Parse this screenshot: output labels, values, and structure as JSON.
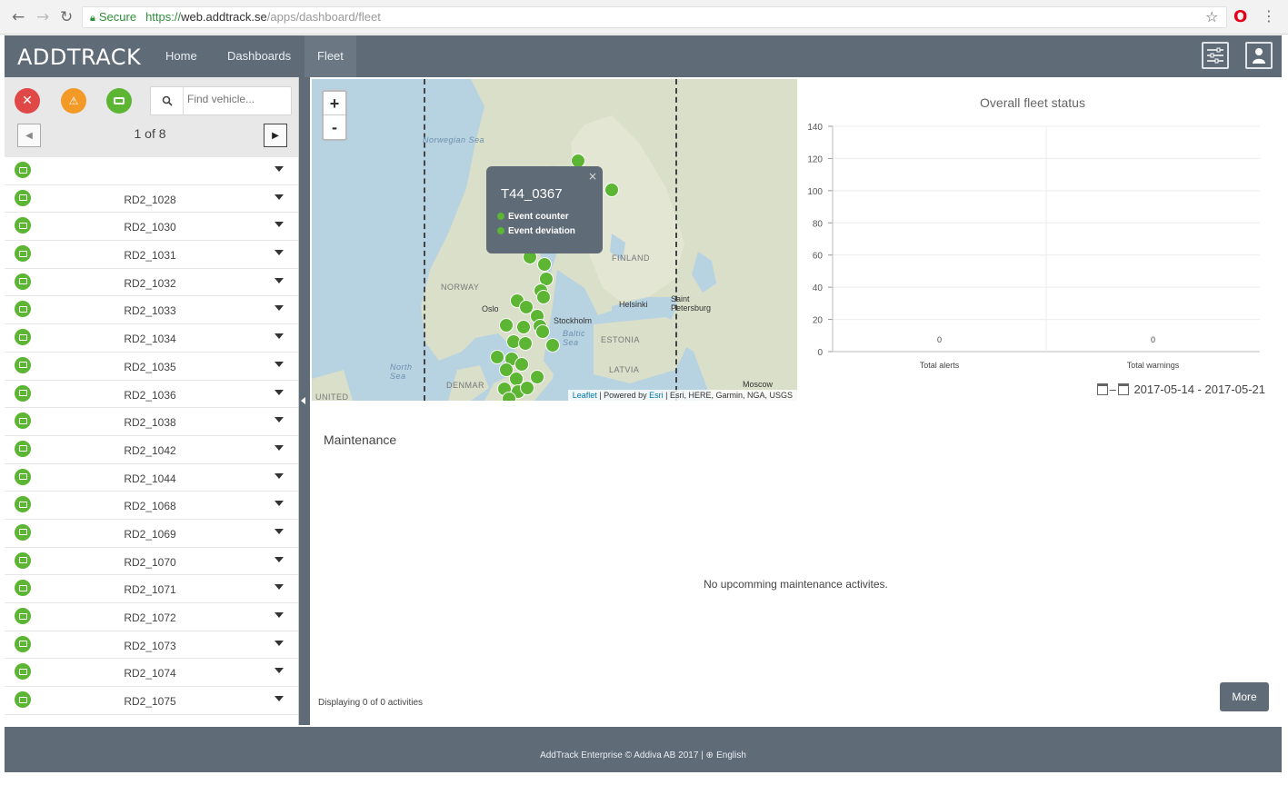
{
  "browser": {
    "secure_label": "Secure",
    "url_scheme": "https://",
    "url_host": "web.addtrack.se",
    "url_path": "/apps/dashboard/fleet"
  },
  "header": {
    "logo": "ADDTRACK",
    "tabs": [
      "Home",
      "Dashboards",
      "Fleet"
    ],
    "active_tab": "Fleet"
  },
  "sidebar": {
    "search_placeholder": "Find vehicle...",
    "pager": "1 of 8",
    "vehicles": [
      "",
      "RD2_1028",
      "RD2_1030",
      "RD2_1031",
      "RD2_1032",
      "RD2_1033",
      "RD2_1034",
      "RD2_1035",
      "RD2_1036",
      "RD2_1038",
      "RD2_1042",
      "RD2_1044",
      "RD2_1068",
      "RD2_1069",
      "RD2_1070",
      "RD2_1071",
      "RD2_1072",
      "RD2_1073",
      "RD2_1074",
      "RD2_1075"
    ]
  },
  "map": {
    "zoom_in": "+",
    "zoom_out": "-",
    "labels": {
      "norwegian_sea": "Norwegian Sea",
      "finland": "FINLAND",
      "norway": "NORWAY",
      "oslo": "Oslo",
      "helsinki": "Helsinki",
      "saint_petersburg": "Saint Petersburg",
      "stockholm": "Stockholm",
      "baltic_sea": "Baltic Sea",
      "estonia": "ESTONIA",
      "latvia": "LATVIA",
      "north_sea": "North Sea",
      "denmark": "DENMAR",
      "moscow": "Moscow",
      "united": "UNITED"
    },
    "popup": {
      "title": "T44_0367",
      "close": "×",
      "rows": [
        "Event counter",
        "Event deviation"
      ]
    },
    "attribution": {
      "leaflet": "Leaflet",
      "powered_by": " | Powered by ",
      "esri": "Esri",
      "rest": " | Esri, HERE, Garmin, NGA, USGS"
    },
    "marker_color": "#5cb533"
  },
  "chart_data": {
    "type": "bar",
    "title": "Overall fleet status",
    "categories": [
      "Total alerts",
      "Total warnings"
    ],
    "values": [
      0,
      0
    ],
    "ylim": [
      0,
      140
    ],
    "yticks": [
      0,
      20,
      40,
      60,
      80,
      100,
      120,
      140
    ],
    "grid": true,
    "date_range": "2017-05-14 - 2017-05-21"
  },
  "maintenance": {
    "title": "Maintenance",
    "empty_message": "No upcomming maintenance activites.",
    "count": "Displaying 0 of 0 activities",
    "more": "More"
  },
  "footer": {
    "text": "AddTrack Enterprise © Addiva AB 2017  |  ",
    "language": "English"
  },
  "colors": {
    "header": "#5f6b77",
    "ok": "#5cb533",
    "warning": "#f39a26",
    "error": "#e04848"
  }
}
